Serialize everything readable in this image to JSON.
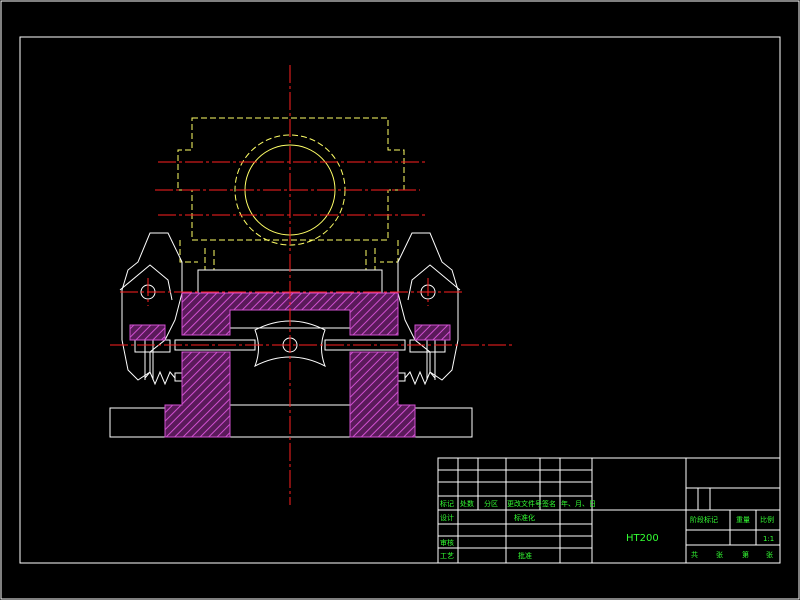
{
  "colors": {
    "background": "#000000",
    "frame": "#ffffff",
    "outline": "#ffffff",
    "hidden": "#ffff66",
    "center": "#ff2020",
    "hatch": "#c040c0",
    "text": "#33ff33"
  },
  "title_block": {
    "material": "HT200",
    "scale": "1:1",
    "row_labels": {
      "mark": "标记",
      "count": "处数",
      "zone": "分区",
      "doc_no": "更改文件号",
      "sign": "签名",
      "date": "年、月、日",
      "design": "设计",
      "standard": "标准化",
      "review": "审核",
      "process": "工艺",
      "approve": "批准"
    },
    "right_labels": {
      "stage_mark": "阶段标记",
      "weight": "重量",
      "scale_label": "比例"
    },
    "sheet_labels": {
      "total": "共",
      "sheet_unit_1": "张",
      "page": "第",
      "sheet_unit_2": "张"
    }
  }
}
